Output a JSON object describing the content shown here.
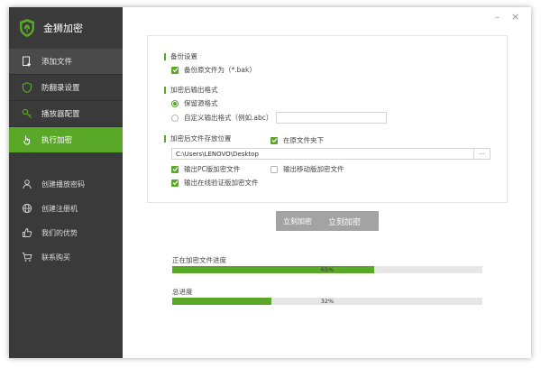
{
  "app": {
    "title": "金狮加密",
    "logo_icon": "shield-leaf-icon"
  },
  "sidebar": {
    "items": [
      {
        "label": "添加文件",
        "icon": "add-file-icon",
        "state": "hover"
      },
      {
        "label": "防翻录设置",
        "icon": "shield-icon",
        "state": "normal"
      },
      {
        "label": "播放器配置",
        "icon": "key-icon",
        "state": "normal"
      },
      {
        "label": "执行加密",
        "icon": "hand-pointer-icon",
        "state": "active"
      }
    ],
    "secondary": [
      {
        "label": "创建播放密码",
        "icon": "user-icon"
      },
      {
        "label": "创建注册机",
        "icon": "globe-icon"
      },
      {
        "label": "我们的优势",
        "icon": "thumbs-up-icon"
      },
      {
        "label": "联系购买",
        "icon": "cart-icon"
      }
    ]
  },
  "window_controls": {
    "minimize": "–",
    "close": "×"
  },
  "settings": {
    "backup": {
      "title": "备份设置",
      "backup_label": "备份原文件为（*.bak）",
      "backup_checked": true
    },
    "output_format": {
      "title": "加密后输出格式",
      "keep_original_label": "保留源格式",
      "custom_label": "自定义输出格式（例如.abc）",
      "selected": "keep_original",
      "custom_value": ""
    },
    "output_location": {
      "title": "加密后文件存放位置",
      "in_source_folder_label": "在原文件夹下",
      "in_source_folder_checked": true,
      "path": "C:\\Users\\LENOVO\\Desktop",
      "browse_label": "···",
      "pc_label": "输出PC版加密文件",
      "pc_checked": true,
      "mobile_label": "输出移动版加密文件",
      "mobile_checked": false,
      "online_label": "输出在线验证版加密文件",
      "online_checked": true
    }
  },
  "actions": {
    "encrypt_label": "立刻加密",
    "encrypt_ghost_label": "立刻加密"
  },
  "progress": {
    "current_label": "正在加密文件进度",
    "current_percent": 65,
    "current_text": "65%",
    "total_label": "总进度",
    "total_percent": 32,
    "total_text": "32%"
  },
  "colors": {
    "accent": "#5aa827",
    "sidebar_bg": "#3a3a3a",
    "button_disabled": "#a3a3a3"
  }
}
